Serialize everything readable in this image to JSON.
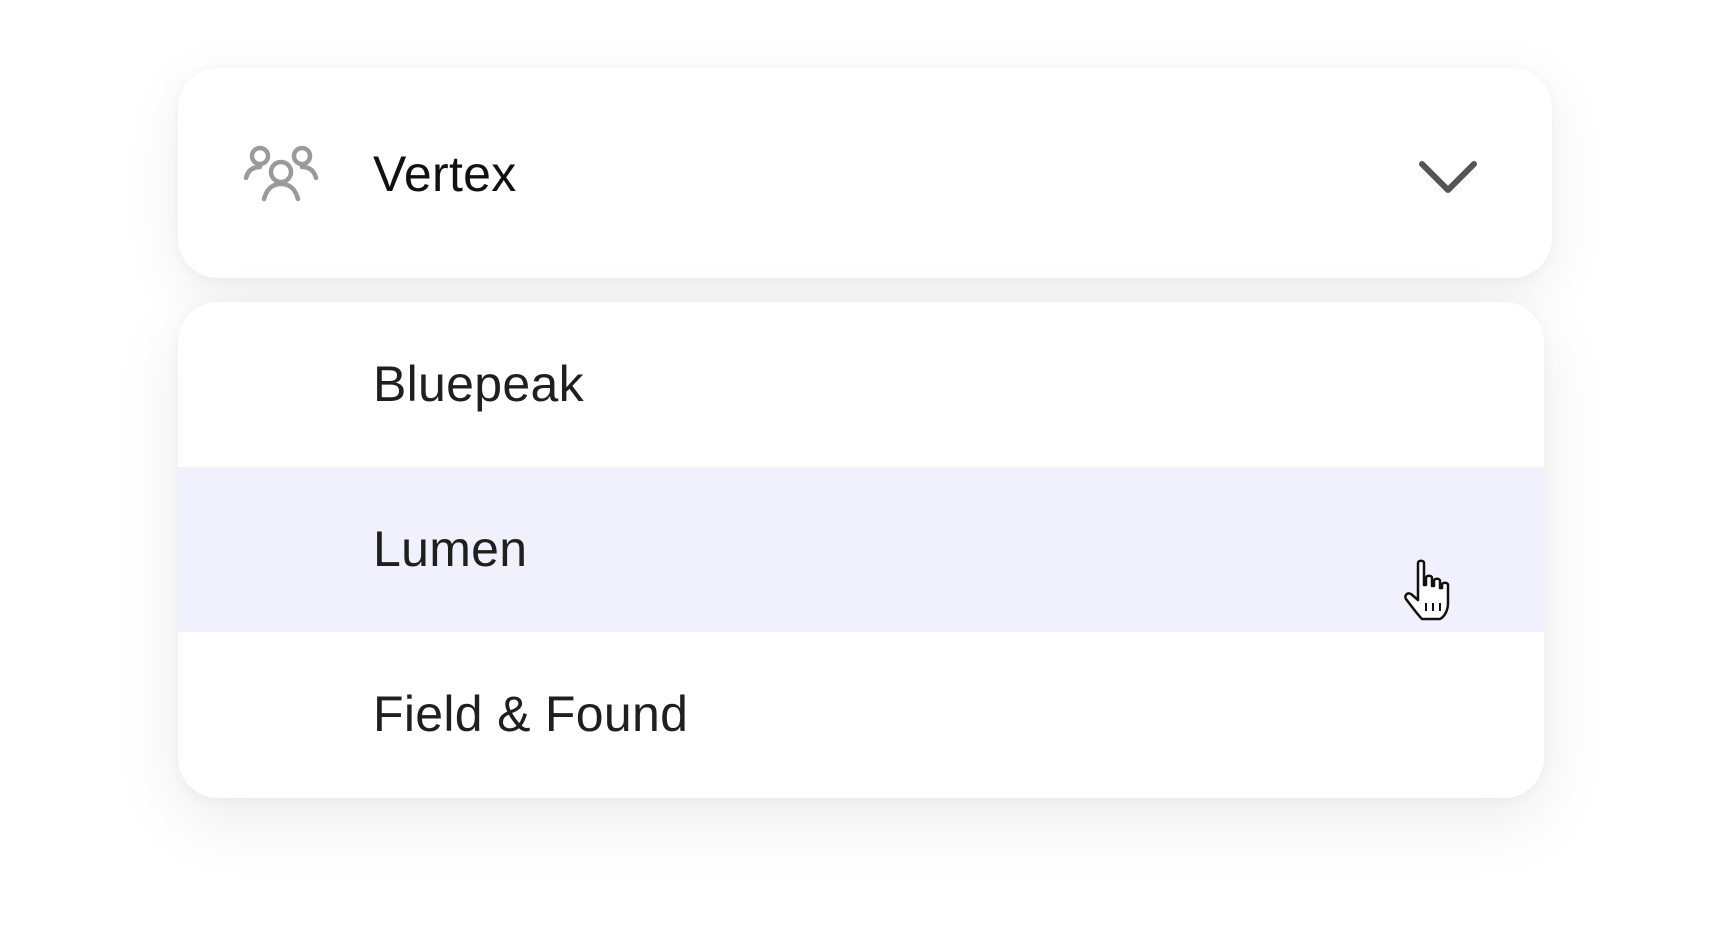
{
  "select": {
    "value": "Vertex",
    "icon": "users-group-icon",
    "chevron_icon": "chevron-down-icon",
    "icon_color": "#9a9a9a",
    "chevron_color": "#555555"
  },
  "options": [
    {
      "label": "Bluepeak",
      "hovered": false
    },
    {
      "label": "Lumen",
      "hovered": true
    },
    {
      "label": "Field & Found",
      "hovered": false
    }
  ],
  "colors": {
    "hover_background": "#f0f1fd",
    "text": "#1f1f1f"
  },
  "cursor": {
    "icon": "hand-pointer-icon"
  }
}
